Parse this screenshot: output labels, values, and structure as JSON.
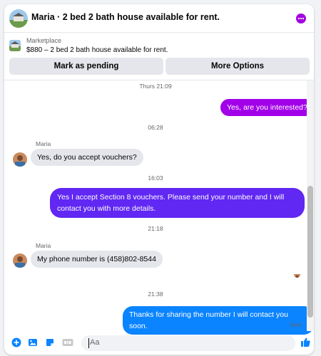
{
  "header": {
    "title": "Maria · 2 bed 2 bath house available for rent.",
    "menu_color": "#a300e0"
  },
  "marketplace": {
    "label": "Marketplace",
    "listing": "$880 – 2 bed 2 bath house available for rent.",
    "mark_pending_label": "Mark as pending",
    "more_options_label": "More Options"
  },
  "thread": {
    "ts1": "Thurs 21:09",
    "msg1": "Yes, are you interested?",
    "ts2": "06:28",
    "sender1": "Maria",
    "msg2": "Yes, do you accept vouchers?",
    "ts3": "16:03",
    "msg3": "Yes I accept Section 8 vouchers. Please send your number and I will contact you with more details.",
    "ts4": "21:18",
    "sender2": "Maria",
    "msg4": "My phone number is (458)802-8544",
    "ts5": "21:38",
    "msg5": "Thanks for sharing the number I will contact you soon.",
    "status": "Sent"
  },
  "composer": {
    "placeholder": "Aa",
    "icons": [
      "plus-circle-icon",
      "image-icon",
      "sticker-icon",
      "gif-icon",
      "emoji-icon",
      "thumbs-up-icon"
    ]
  },
  "colors": {
    "accent_blue": "#0b84ff",
    "bubble_purple": "#a200e8",
    "bubble_violet": "#6127f3",
    "incoming_bubble": "#e4e6eb"
  }
}
